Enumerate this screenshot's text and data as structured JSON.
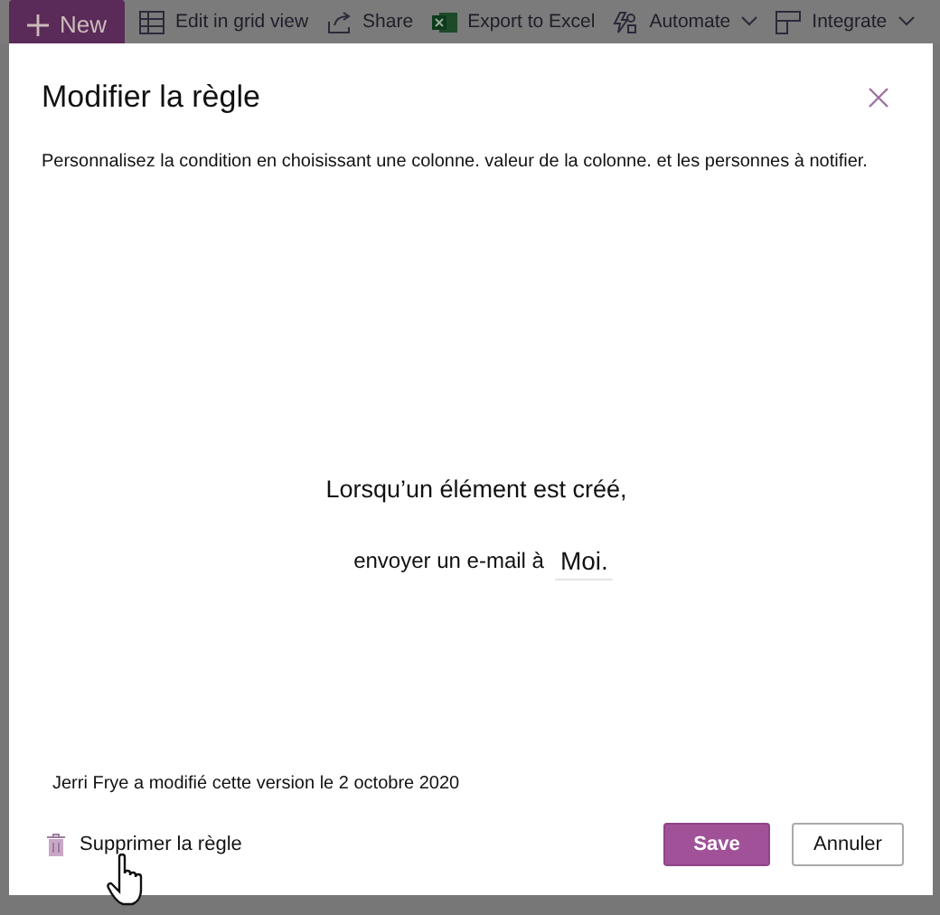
{
  "toolbar": {
    "items": [
      {
        "kind": "new",
        "label": "New"
      },
      {
        "kind": "grid",
        "label": "Edit in grid view"
      },
      {
        "kind": "share",
        "label": "Share"
      },
      {
        "kind": "excel",
        "label": "Export to Excel"
      },
      {
        "kind": "automate",
        "label": "Automate",
        "dropdown": true
      },
      {
        "kind": "integrate",
        "label": "Integrate",
        "dropdown": true
      }
    ]
  },
  "dialog": {
    "title": "Modifier la règle",
    "description": "Personnalisez la condition en choisissant une colonne. valeur de la colonne. et les personnes à notifier.",
    "condition": "Lorsqu’un élément est créé,",
    "action": "envoyer un e-mail à",
    "recipient": "Moi.",
    "modified": "Jerri Frye a modifié cette version le 2 octobre 2020",
    "delete_link": "Supprimer la règle",
    "buttons": [
      {
        "kind": "primary",
        "label": "Save"
      },
      {
        "kind": "default",
        "label": "Annuler"
      }
    ]
  }
}
